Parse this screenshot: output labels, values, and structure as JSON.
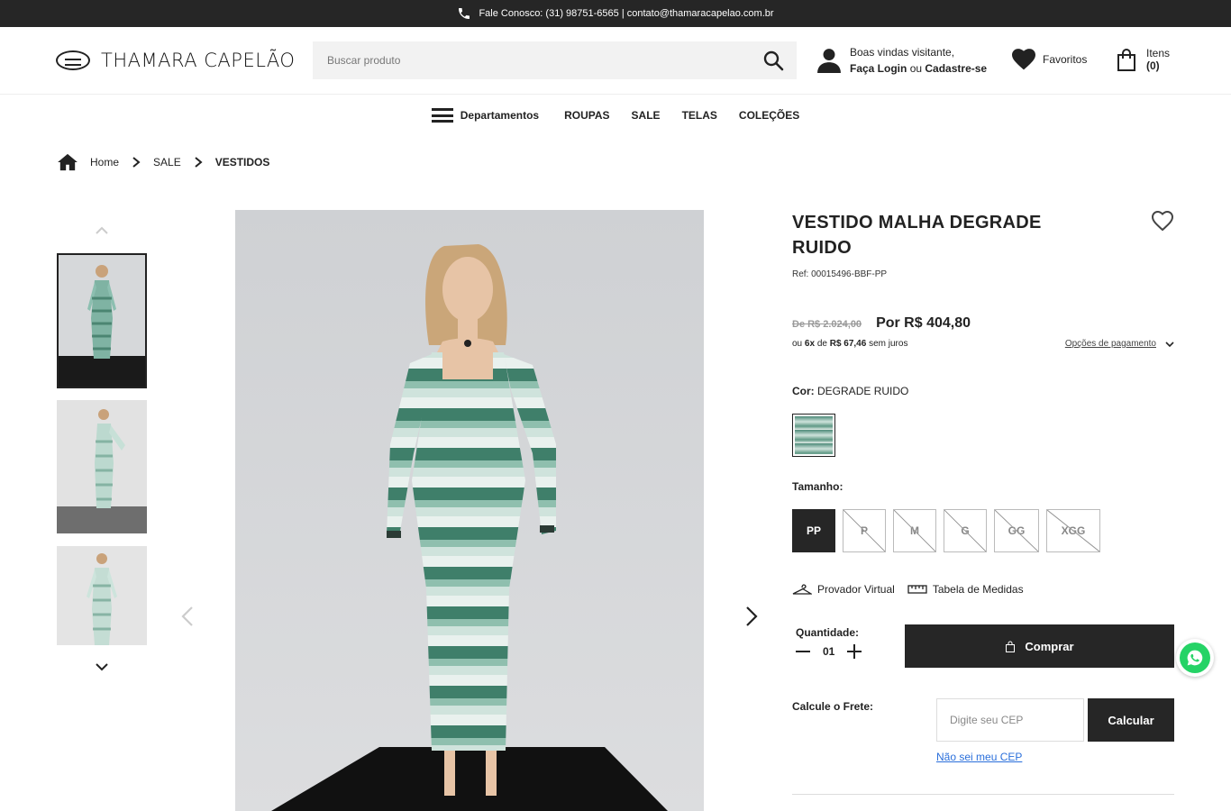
{
  "topbar": {
    "contact_text": "Fale Conosco: (31) 98751-6565 | contato@thamaracapelao.com.br",
    "icon": "phone-icon"
  },
  "header": {
    "logo_text": "THAMARA CAPELÃO",
    "search_placeholder": "Buscar produto",
    "welcome": "Boas vindas visitante,",
    "login_label": "Faça Login",
    "or_label": "ou",
    "register_label": "Cadastre-se",
    "favorites_label": "Favoritos",
    "cart_label": "Itens",
    "cart_count": "(0)"
  },
  "nav": {
    "departments_label": "Departamentos",
    "items": [
      "ROUPAS",
      "SALE",
      "TELAS",
      "COLEÇÕES"
    ]
  },
  "breadcrumb": {
    "home": "Home",
    "level1": "SALE",
    "current": "VESTIDOS"
  },
  "product": {
    "title": "VESTIDO MALHA DEGRADE RUIDO",
    "ref": "Ref: 00015496-BBF-PP",
    "old_price": "De R$ 2.024,00",
    "new_price": "Por R$ 404,80",
    "installments": {
      "prefix": "ou",
      "count": "6x",
      "mid": "de",
      "value": "R$ 67,46",
      "suffix": "sem juros"
    },
    "payment_options_label": "Opções de pagamento",
    "color_label": "Cor:",
    "color_value": "DEGRADE RUIDO",
    "size_label": "Tamanho:",
    "sizes": [
      {
        "label": "PP",
        "selected": true,
        "available": true
      },
      {
        "label": "P",
        "selected": false,
        "available": false
      },
      {
        "label": "M",
        "selected": false,
        "available": false
      },
      {
        "label": "G",
        "selected": false,
        "available": false
      },
      {
        "label": "GG",
        "selected": false,
        "available": false
      },
      {
        "label": "XGG",
        "selected": false,
        "available": false
      }
    ],
    "virtual_fitting_label": "Provador Virtual",
    "size_chart_label": "Tabela de Medidas",
    "quantity_label": "Quantidade:",
    "quantity_value": "01",
    "buy_label": "Comprar",
    "shipping_label": "Calcule o Frete:",
    "cep_placeholder": "Digite seu CEP",
    "calc_label": "Calcular",
    "no_cep_label": "Não sei meu CEP"
  },
  "colors": {
    "dark": "#262626",
    "link": "#2a6fdb",
    "whatsapp": "#25d366"
  }
}
